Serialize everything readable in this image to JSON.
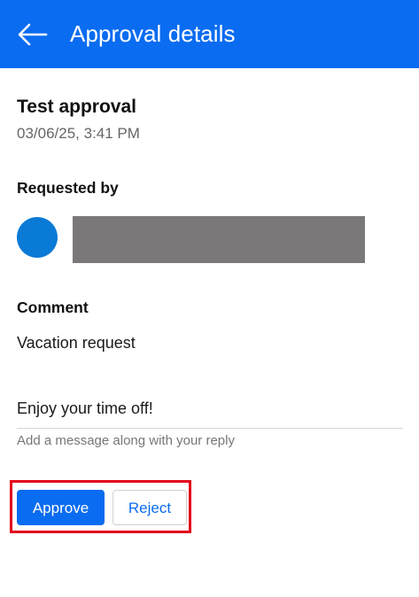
{
  "header": {
    "title": "Approval details",
    "back_icon": "arrow-left-icon",
    "background_color": "#0a6cf0"
  },
  "approval": {
    "title": "Test approval",
    "date": "03/06/25, 3:41 PM"
  },
  "requested_by": {
    "label": "Requested by",
    "avatar_color": "#0a7ad7"
  },
  "comment": {
    "label": "Comment",
    "text": "Vacation request"
  },
  "reply": {
    "value": "Enjoy your time off!",
    "hint": "Add a message along with your reply"
  },
  "actions": {
    "approve_label": "Approve",
    "reject_label": "Reject",
    "highlight_color": "#e3001b"
  }
}
